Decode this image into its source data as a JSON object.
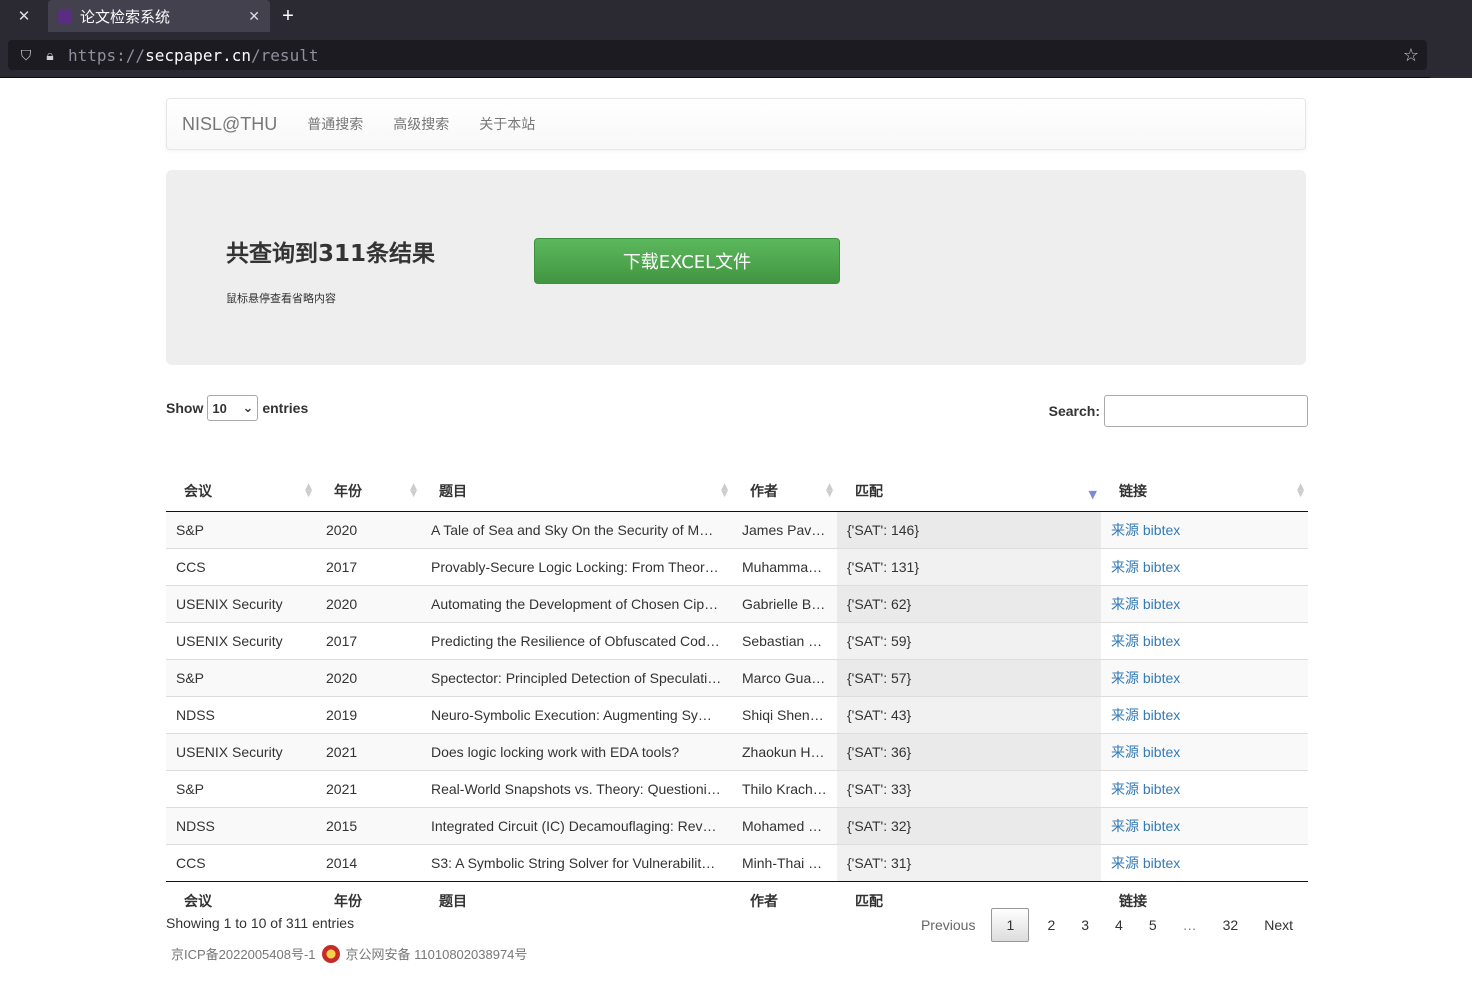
{
  "browser": {
    "tab_title": "论文检索系统",
    "url_prefix": "https://",
    "url_host": "secpaper.cn",
    "url_path": "/result"
  },
  "nav": {
    "brand": "NISL@THU",
    "links": [
      "普通搜索",
      "高级搜索",
      "关于本站"
    ]
  },
  "jumbotron": {
    "title": "共查询到311条结果",
    "hint": "鼠标悬停查看省略内容",
    "download_label": "下载EXCEL文件"
  },
  "controls": {
    "show_label": "Show",
    "entries_label": "entries",
    "page_size": "10",
    "search_label": "Search:"
  },
  "table": {
    "headers": [
      "会议",
      "年份",
      "题目",
      "作者",
      "匹配",
      "链接"
    ],
    "rows": [
      {
        "conf": "S&P",
        "year": "2020",
        "title": "A Tale of Sea and Sky On the Security of M…",
        "author": "James Pav…",
        "match": "{'SAT': 146}",
        "link1": "来源",
        "link2": "bibtex"
      },
      {
        "conf": "CCS",
        "year": "2017",
        "title": "Provably-Secure Logic Locking: From Theor…",
        "author": "Muhamma…",
        "match": "{'SAT': 131}",
        "link1": "来源",
        "link2": "bibtex"
      },
      {
        "conf": "USENIX Security",
        "year": "2020",
        "title": "Automating the Development of Chosen Cip…",
        "author": "Gabrielle B…",
        "match": "{'SAT': 62}",
        "link1": "来源",
        "link2": "bibtex"
      },
      {
        "conf": "USENIX Security",
        "year": "2017",
        "title": "Predicting the Resilience of Obfuscated Cod…",
        "author": "Sebastian …",
        "match": "{'SAT': 59}",
        "link1": "来源",
        "link2": "bibtex"
      },
      {
        "conf": "S&P",
        "year": "2020",
        "title": "Spectector: Principled Detection of Speculati…",
        "author": "Marco Gua…",
        "match": "{'SAT': 57}",
        "link1": "来源",
        "link2": "bibtex"
      },
      {
        "conf": "NDSS",
        "year": "2019",
        "title": "Neuro-Symbolic Execution: Augmenting Sy…",
        "author": "Shiqi Shen…",
        "match": "{'SAT': 43}",
        "link1": "来源",
        "link2": "bibtex"
      },
      {
        "conf": "USENIX Security",
        "year": "2021",
        "title": "Does logic locking work with EDA tools?",
        "author": "Zhaokun H…",
        "match": "{'SAT': 36}",
        "link1": "来源",
        "link2": "bibtex"
      },
      {
        "conf": "S&P",
        "year": "2021",
        "title": "Real-World Snapshots vs. Theory: Questioni…",
        "author": "Thilo Krach…",
        "match": "{'SAT': 33}",
        "link1": "来源",
        "link2": "bibtex"
      },
      {
        "conf": "NDSS",
        "year": "2015",
        "title": "Integrated Circuit (IC) Decamouflaging: Rev…",
        "author": "Mohamed …",
        "match": "{'SAT': 32}",
        "link1": "来源",
        "link2": "bibtex"
      },
      {
        "conf": "CCS",
        "year": "2014",
        "title": "S3: A Symbolic String Solver for Vulnerabilit…",
        "author": "Minh-Thai …",
        "match": "{'SAT': 31}",
        "link1": "来源",
        "link2": "bibtex"
      }
    ]
  },
  "pagination": {
    "info": "Showing 1 to 10 of 311 entries",
    "previous": "Previous",
    "pages": [
      "1",
      "2",
      "3",
      "4",
      "5",
      "…",
      "32"
    ],
    "next": "Next"
  },
  "footer": {
    "icp": "京ICP备2022005408号-1",
    "police": "京公网安备 11010802038974号"
  }
}
